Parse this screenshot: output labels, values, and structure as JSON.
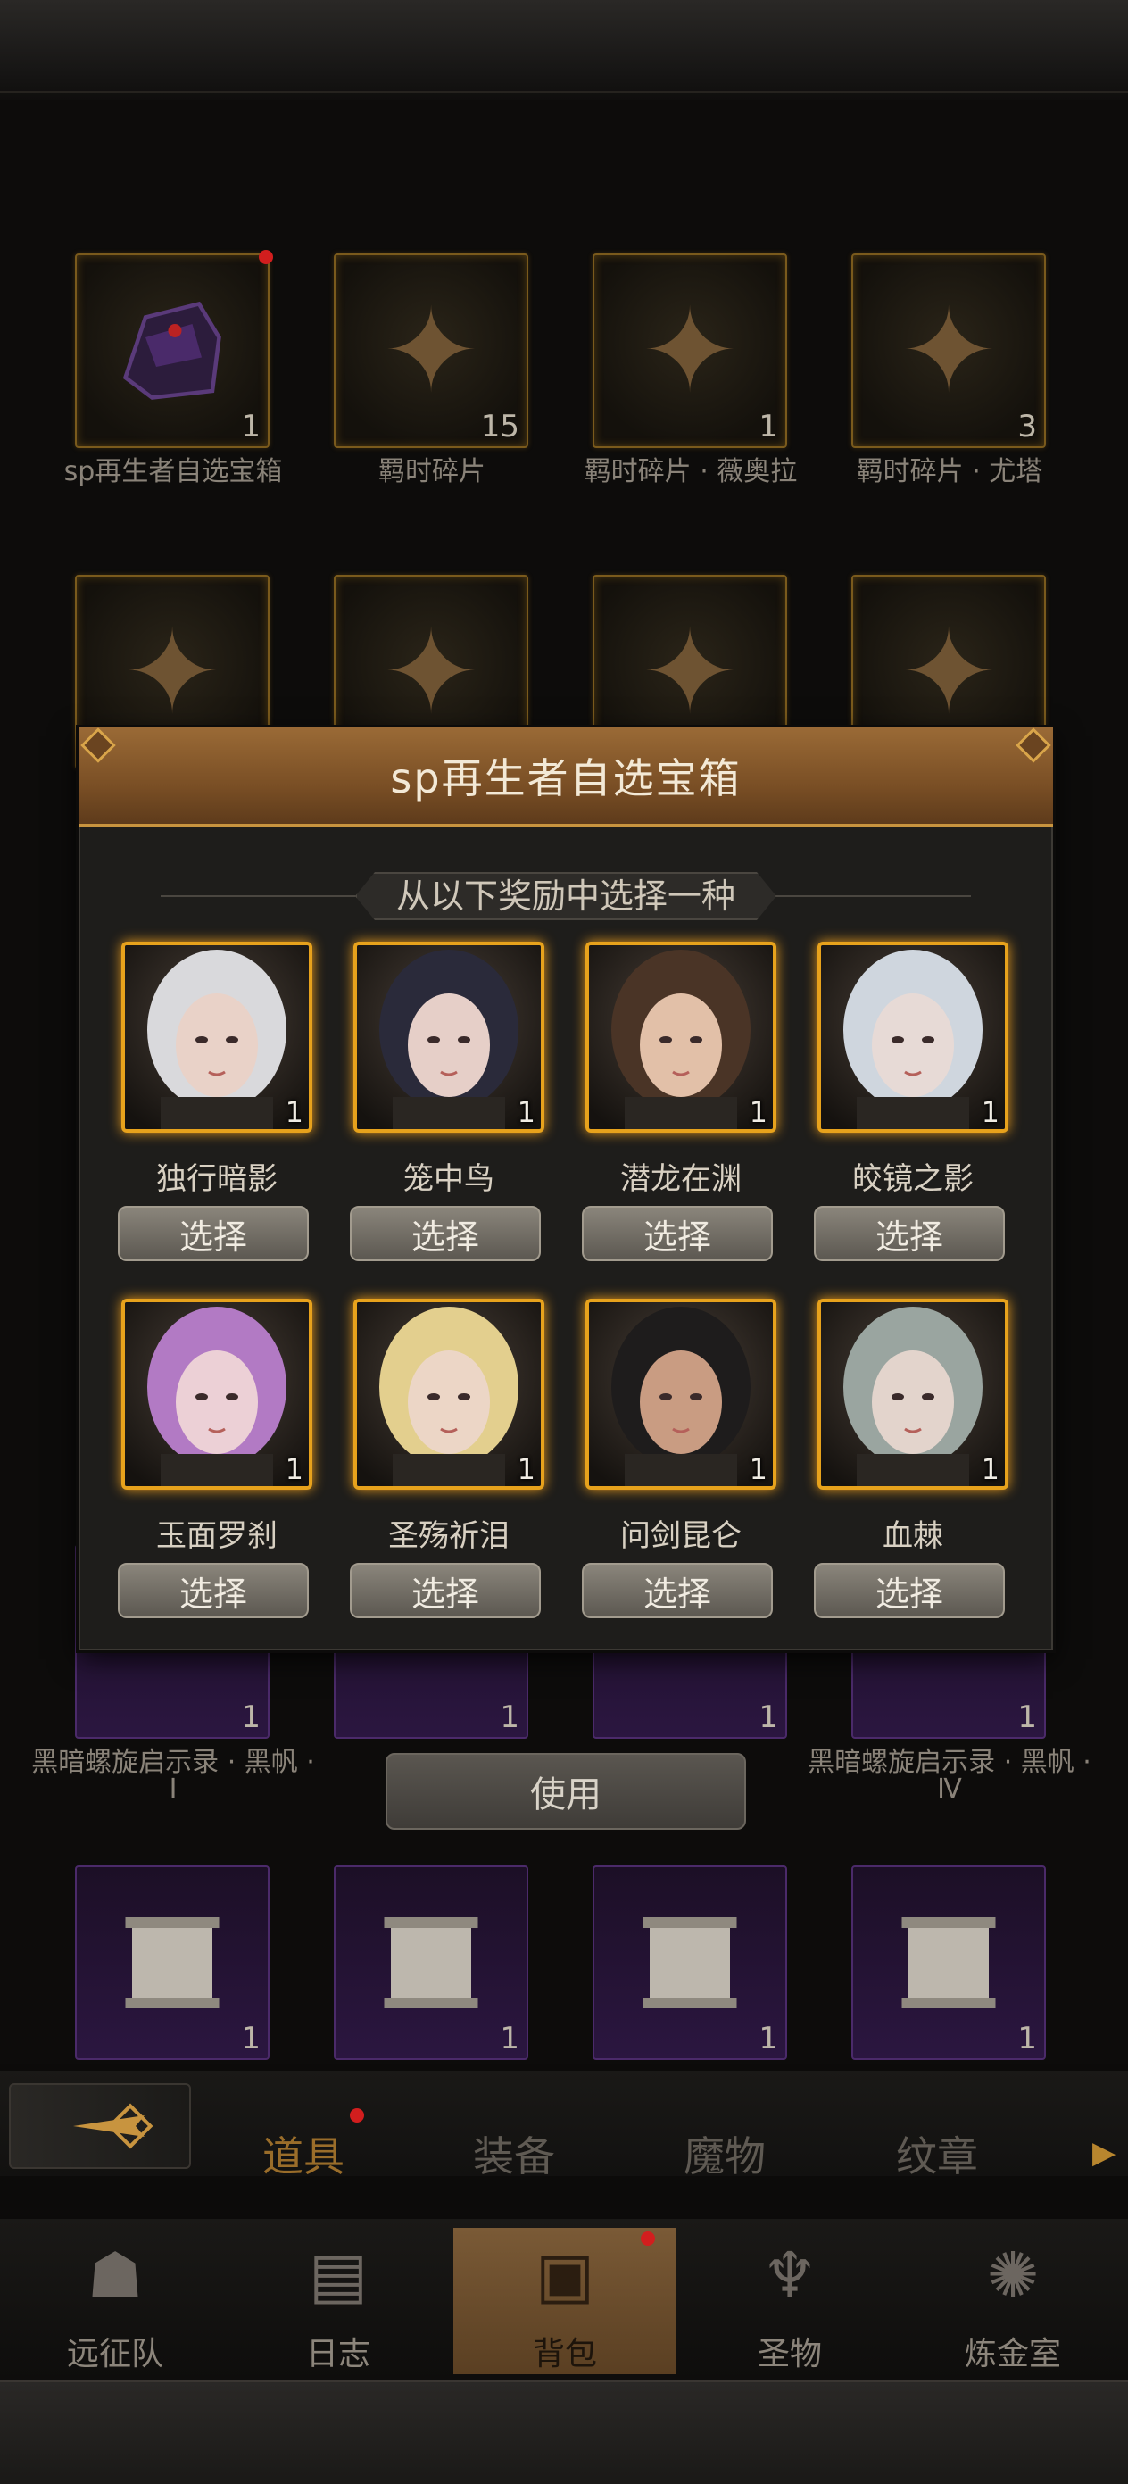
{
  "inventory": {
    "row1": [
      {
        "label": "sp再生者自选宝箱",
        "count": "1",
        "icon": "helmet-chest-icon"
      },
      {
        "label": "羁时碎片",
        "count": "15",
        "icon": "puzzle-question-icon"
      },
      {
        "label": "羁时碎片 · 薇奥拉",
        "count": "1",
        "icon": "puzzle-icon"
      },
      {
        "label": "羁时碎片 · 尤塔",
        "count": "3",
        "icon": "puzzle-icon"
      }
    ],
    "row3": [
      {
        "label": "黑暗螺旋启示录 · 黑帆 · Ⅰ",
        "count": "1"
      },
      {
        "label": "",
        "count": "1"
      },
      {
        "label": "",
        "count": "1"
      },
      {
        "label": "黑暗螺旋启示录 · 黑帆 · Ⅳ",
        "count": "1"
      }
    ],
    "row4_counts": [
      "1",
      "1",
      "1",
      "1"
    ],
    "use_label": "使用"
  },
  "modal": {
    "title": "sp再生者自选宝箱",
    "subtitle": "从以下奖励中选择一种",
    "select_label": "选择",
    "rewards": [
      {
        "name": "独行暗影",
        "count": "1",
        "hair": "#d9d9dc",
        "skin": "#e9d2c8"
      },
      {
        "name": "笼中鸟",
        "count": "1",
        "hair": "#2a2a3a",
        "skin": "#e6cfc8"
      },
      {
        "name": "潜龙在渊",
        "count": "1",
        "hair": "#4a3426",
        "skin": "#e2c0a8"
      },
      {
        "name": "皎镜之影",
        "count": "1",
        "hair": "#cfd6de",
        "skin": "#e7dad6"
      },
      {
        "name": "玉面罗刹",
        "count": "1",
        "hair": "#b27ac4",
        "skin": "#ecd0d6"
      },
      {
        "name": "圣殇祈泪",
        "count": "1",
        "hair": "#e3cf8e",
        "skin": "#ecd6c6"
      },
      {
        "name": "问剑昆仑",
        "count": "1",
        "hair": "#1e1c1c",
        "skin": "#c99c82"
      },
      {
        "name": "血棘",
        "count": "1",
        "hair": "#9aa5a0",
        "skin": "#e3d4cc"
      }
    ]
  },
  "tabs": {
    "items": [
      "道具",
      "装备",
      "魔物",
      "纹章"
    ],
    "active": "道具"
  },
  "nav": {
    "items": [
      {
        "label": "远征队",
        "icon": "viking-helmet-icon"
      },
      {
        "label": "日志",
        "icon": "journal-map-icon"
      },
      {
        "label": "背包",
        "icon": "backpack-chest-icon"
      },
      {
        "label": "圣物",
        "icon": "relic-torch-icon"
      },
      {
        "label": "炼金室",
        "icon": "alchemy-symbol-icon"
      }
    ],
    "active": "背包"
  },
  "colors": {
    "accent_gold": "#e7a21c",
    "header_brown": "#7a4f25",
    "notify_red": "#d21e1e"
  }
}
